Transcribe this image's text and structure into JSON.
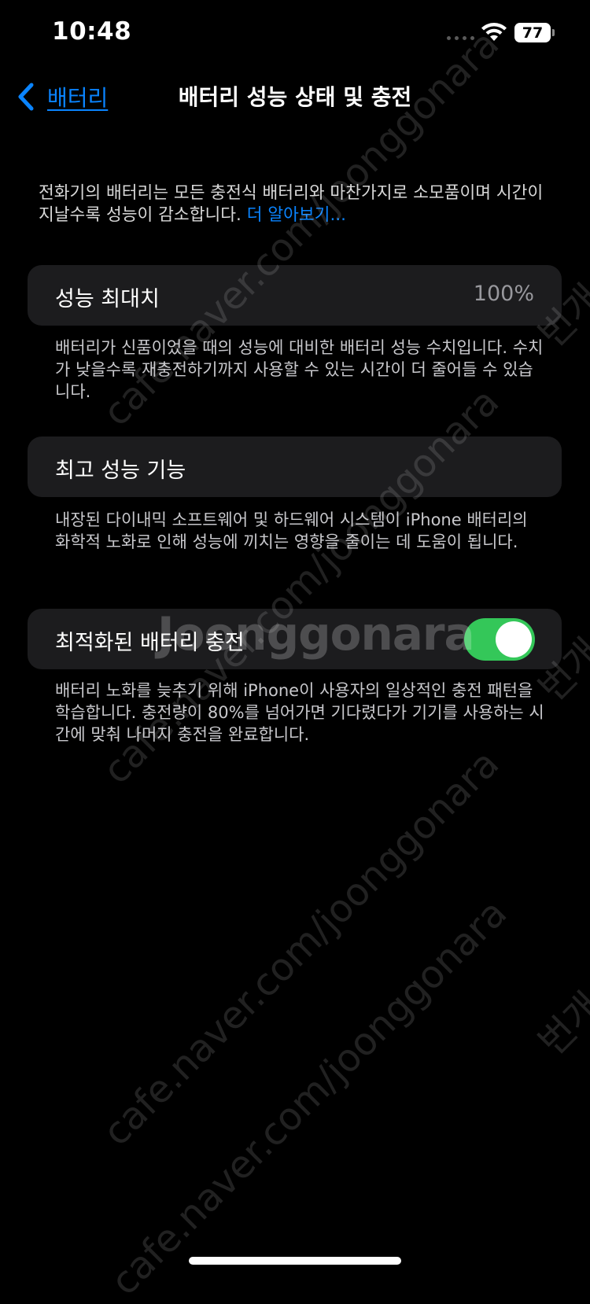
{
  "status_bar": {
    "time": "10:48",
    "battery_level": "77"
  },
  "nav": {
    "back_label": "배터리",
    "title": "배터리 성능 상태 및 충전"
  },
  "intro": {
    "text": "전화기의 배터리는 모든 충전식 배터리와 마찬가지로 소모품이며 시간이 지날수록 성능이 감소합니다. ",
    "link": "더 알아보기..."
  },
  "maximum_capacity": {
    "label": "성능 최대치",
    "value": "100%",
    "footer": "배터리가 신품이었을 때의 성능에 대비한 배터리 성능 수치입니다. 수치가 낮을수록 재충전하기까지 사용할 수 있는 시간이 더 줄어들 수 있습니다."
  },
  "peak_performance": {
    "label": "최고 성능 기능",
    "footer": "내장된 다이내믹 소프트웨어 및 하드웨어 시스템이 iPhone 배터리의 화학적 노화로 인해 성능에 끼치는 영향을 줄이는 데 도움이 됩니다."
  },
  "optimized_charging": {
    "label": "최적화된 배터리 충전",
    "enabled": true,
    "footer": "배터리 노화를 늦추기 위해 iPhone이 사용자의 일상적인 충전 패턴을 학습합니다. 충전량이 80%를 넘어가면 기다렸다가 기기를 사용하는 시간에 맞춰 나머지 충전을 완료합니다."
  },
  "watermark": {
    "text": "cafe.naver.com/joonggonara",
    "logo": "Joonggonara",
    "side": "번개"
  },
  "colors": {
    "accent": "#0a84ff",
    "toggle_on": "#34c759",
    "cell_bg": "#1c1c1e",
    "background": "#000000"
  }
}
